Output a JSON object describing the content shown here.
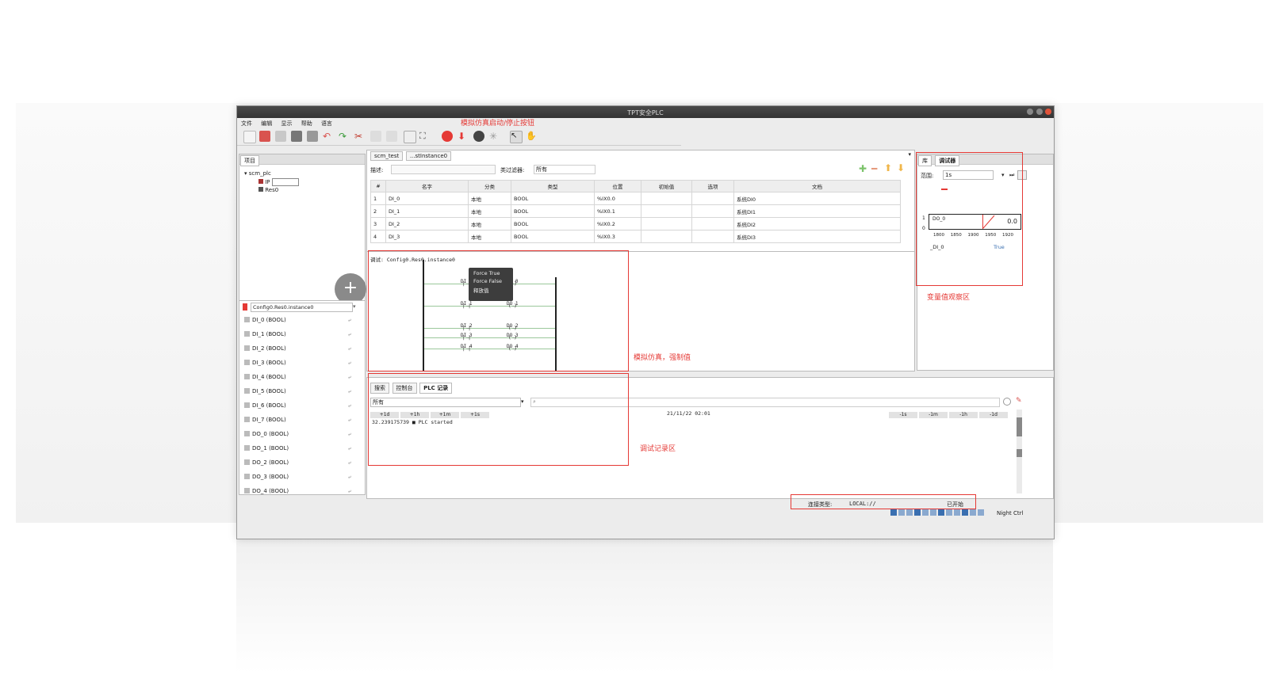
{
  "window": {
    "title": "TPT安全PLC"
  },
  "menu": [
    "文件",
    "编辑",
    "显示",
    "帮助",
    "语言"
  ],
  "annotations": {
    "sim_button": "模拟仿真启动/停止按钮",
    "sim_force": "模拟仿真，强制值",
    "variable_watch": "变量值观察区",
    "debug_log": "调试记录区"
  },
  "project_tree": {
    "tab": "项目",
    "root": "scm_plc",
    "child1": "IP",
    "child2": "Res0"
  },
  "editor_tabs": [
    "scm_test",
    "...stInstance0"
  ],
  "var_editor": {
    "desc_label": "描述:",
    "filter_label": "类过滤器:",
    "filter_value": "所有",
    "columns": [
      "#",
      "名字",
      "分类",
      "类型",
      "位置",
      "初始值",
      "选项",
      "文档"
    ],
    "rows": [
      [
        "1",
        "DI_0",
        "本地",
        "BOOL",
        "%IX0.0",
        "",
        "",
        "系统DI0"
      ],
      [
        "2",
        "DI_1",
        "本地",
        "BOOL",
        "%IX0.1",
        "",
        "",
        "系统DI1"
      ],
      [
        "3",
        "DI_2",
        "本地",
        "BOOL",
        "%IX0.2",
        "",
        "",
        "系统DI2"
      ],
      [
        "4",
        "DI_3",
        "本地",
        "BOOL",
        "%IX0.3",
        "",
        "",
        "系统DI3"
      ]
    ]
  },
  "ladder": {
    "header": "调试: Config0.Res0.instance0",
    "menu": [
      "Force True",
      "Force False",
      "释放值"
    ],
    "di_labels": [
      "DI_0",
      "DI_1",
      "DI_2",
      "DI_3",
      "DI_4"
    ],
    "do_labels": [
      "DO_0",
      "DO_1",
      "DO_2",
      "DO_3",
      "DO_4"
    ]
  },
  "instance_selector": "Config0.Res0.instance0",
  "variables": [
    "DI_0 (BOOL)",
    "DI_1 (BOOL)",
    "DI_2 (BOOL)",
    "DI_3 (BOOL)",
    "DI_4 (BOOL)",
    "DI_5 (BOOL)",
    "DI_6 (BOOL)",
    "DI_7 (BOOL)",
    "DO_0 (BOOL)",
    "DO_1 (BOOL)",
    "DO_2 (BOOL)",
    "DO_3 (BOOL)",
    "DO_4 (BOOL)"
  ],
  "debug_panel": {
    "tabs": [
      "库",
      "调试器"
    ],
    "range_label": "范围:",
    "range_value": "1s",
    "var_name": "DO_0",
    "value": "0.0",
    "x_ticks": [
      "1800",
      "1850",
      "1900",
      "1950",
      "1920"
    ],
    "bottom_var": "_DI_0",
    "bottom_value": "True"
  },
  "log_panel": {
    "tabs": [
      "搜索",
      "控制台",
      "PLC 记录"
    ],
    "filter": "所有",
    "left_buttons": [
      "+1d",
      "+1h",
      "+1m",
      "+1s"
    ],
    "right_buttons": [
      "-1s",
      "-1m",
      "-1h",
      "-1d"
    ],
    "date": "21/11/22 02:01",
    "entry": "32.239175739 ■ PLC started"
  },
  "status": {
    "mode_label": "连接类型:",
    "mode_value": "LOCAL://",
    "state": "已开始",
    "extra": "Night Ctrl"
  }
}
